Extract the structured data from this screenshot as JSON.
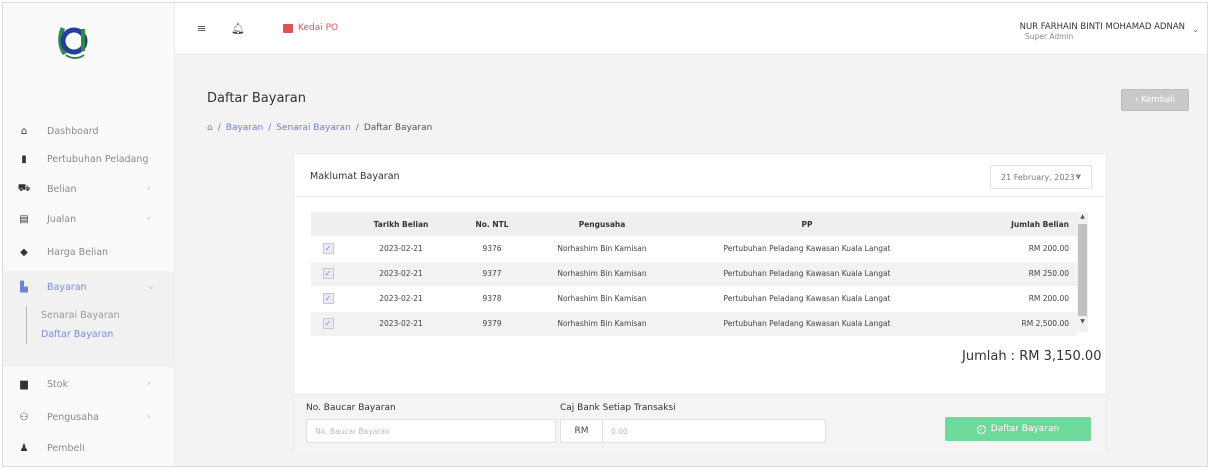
{
  "topbar": {
    "shop_label": "Kedai PO",
    "user_name": "NUR FARHAIN BINTI MOHAMAD ADNAN",
    "user_role": "Super Admin",
    "icons": [
      "menu-icon",
      "bell-icon",
      "shop-icon",
      "chevron-down-icon"
    ]
  },
  "sidebar": {
    "items": [
      {
        "label": "Dashboard",
        "icon": "home-icon"
      },
      {
        "label": "Pertubuhan Peladang",
        "icon": "bookmark-icon"
      },
      {
        "label": "Belian",
        "icon": "basket-icon",
        "chevron": "›"
      },
      {
        "label": "Jualan",
        "icon": "cash-icon",
        "chevron": "›"
      },
      {
        "label": "Harga Belian",
        "icon": "tag-icon"
      },
      {
        "label": "Bayaran",
        "icon": "bank-icon",
        "chevron": "⌄"
      },
      {
        "label": "Stok",
        "icon": "box-icon",
        "chevron": "›"
      },
      {
        "label": "Pengusaha",
        "icon": "users-icon",
        "chevron": "›"
      },
      {
        "label": "Pembeli",
        "icon": "user-icon"
      }
    ],
    "subitems": [
      "Senarai Bayaran",
      "Daftar Bayaran"
    ]
  },
  "page": {
    "title": "Daftar Bayaran",
    "back_label": "‹  Kembali",
    "breadcrumb": [
      "Bayaran",
      "Senarai Bayaran",
      "Daftar Bayaran"
    ]
  },
  "card": {
    "title": "Maklumat Bayaran",
    "date": "21 February, 2023",
    "columns": [
      "",
      "Tarikh Belian",
      "No. NTL",
      "Pengusaha",
      "PP",
      "Jumlah Belian"
    ],
    "rows": [
      {
        "checked": true,
        "date": "2023-02-21",
        "ntl": "9376",
        "pengusaha": "Norhashim Bin Kamisan",
        "pp": "Pertubuhan Peladang Kawasan Kuala Langat",
        "amount": "RM 200.00"
      },
      {
        "checked": true,
        "date": "2023-02-21",
        "ntl": "9377",
        "pengusaha": "Norhashim Bin Kamisan",
        "pp": "Pertubuhan Peladang Kawasan Kuala Langat",
        "amount": "RM 250.00"
      },
      {
        "checked": true,
        "date": "2023-02-21",
        "ntl": "9378",
        "pengusaha": "Norhashim Bin Kamisan",
        "pp": "Pertubuhan Peladang Kawasan Kuala Langat",
        "amount": "RM 200.00"
      },
      {
        "checked": true,
        "date": "2023-02-21",
        "ntl": "9379",
        "pengusaha": "Norhashim Bin Kamisan",
        "pp": "Pertubuhan Peladang Kawasan Kuala Langat",
        "amount": "RM 2,500.00"
      }
    ],
    "total": "Jumlah : RM 3,150.00"
  },
  "form": {
    "voucher_label": "No. Baucar Bayaran",
    "voucher_placeholder": "No. Baucar Bayaran",
    "bank_charge_label": "Caj Bank Setiap Transaksi",
    "currency": "RM",
    "bank_charge_placeholder": "0.00",
    "submit_label": "Daftar Bayaran"
  },
  "colors": {
    "accent": "#6d7fd8",
    "shop": "#e05353",
    "submit": "#6fd99c"
  }
}
